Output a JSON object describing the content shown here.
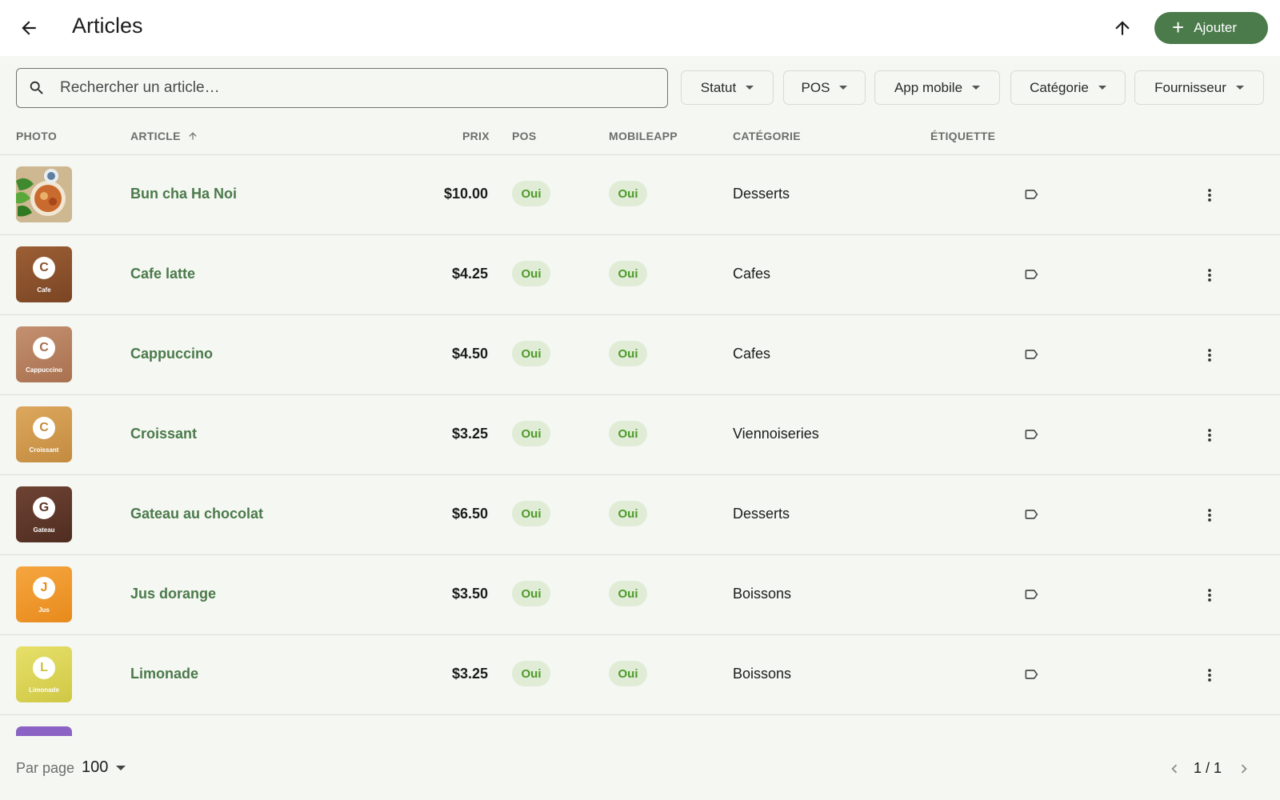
{
  "header": {
    "title": "Articles",
    "add_label": "Ajouter"
  },
  "search": {
    "placeholder": "Rechercher un article…"
  },
  "filters": [
    "Statut",
    "POS",
    "App mobile",
    "Catégorie",
    "Fournisseur"
  ],
  "columns": {
    "photo": "PHOTO",
    "article": "ARTICLE",
    "prix": "PRIX",
    "pos": "POS",
    "mobileapp": "MOBILEAPP",
    "categorie": "CATÉGORIE",
    "etiquette": "ÉTIQUETTE"
  },
  "rows": [
    {
      "name": "Bun cha Ha Noi",
      "price": "$10.00",
      "pos": "Oui",
      "mobile": "Oui",
      "category": "Desserts",
      "photo": {
        "type": "image"
      }
    },
    {
      "name": "Cafe latte",
      "price": "$4.25",
      "pos": "Oui",
      "mobile": "Oui",
      "category": "Cafes",
      "photo": {
        "letter": "C",
        "label": "Cafe",
        "color": "#9c5f35",
        "color2": "#7a4524",
        "letter_color": "#8a5230"
      }
    },
    {
      "name": "Cappuccino",
      "price": "$4.50",
      "pos": "Oui",
      "mobile": "Oui",
      "category": "Cafes",
      "photo": {
        "letter": "C",
        "label": "Cappuccino",
        "color": "#c49070",
        "color2": "#a8714f",
        "letter_color": "#a56e4b"
      }
    },
    {
      "name": "Croissant",
      "price": "$3.25",
      "pos": "Oui",
      "mobile": "Oui",
      "category": "Viennoiseries",
      "photo": {
        "letter": "C",
        "label": "Croissant",
        "color": "#dca85e",
        "color2": "#c38b3f",
        "letter_color": "#c38b3f"
      }
    },
    {
      "name": "Gateau au chocolat",
      "price": "$6.50",
      "pos": "Oui",
      "mobile": "Oui",
      "category": "Desserts",
      "photo": {
        "letter": "G",
        "label": "Gateau",
        "color": "#6e4333",
        "color2": "#4f2d21",
        "letter_color": "#5c3628"
      }
    },
    {
      "name": "Jus dorange",
      "price": "$3.50",
      "pos": "Oui",
      "mobile": "Oui",
      "category": "Boissons",
      "photo": {
        "letter": "J",
        "label": "Jus",
        "color": "#f5a640",
        "color2": "#e88a1c",
        "letter_color": "#e88a1c"
      }
    },
    {
      "name": "Limonade",
      "price": "$3.25",
      "pos": "Oui",
      "mobile": "Oui",
      "category": "Boissons",
      "photo": {
        "letter": "L",
        "label": "Limonade",
        "color": "#e6e06a",
        "color2": "#cfc845",
        "letter_color": "#c9c23d"
      }
    }
  ],
  "partial_row": {
    "color": "#8a63c4"
  },
  "footer": {
    "per_page_label": "Par page",
    "per_page_value": "100",
    "page_indicator": "1 / 1"
  },
  "colors": {
    "accent": "#4b7a4b",
    "badge_bg": "#e0ecd6",
    "badge_text": "#4b9a28"
  }
}
